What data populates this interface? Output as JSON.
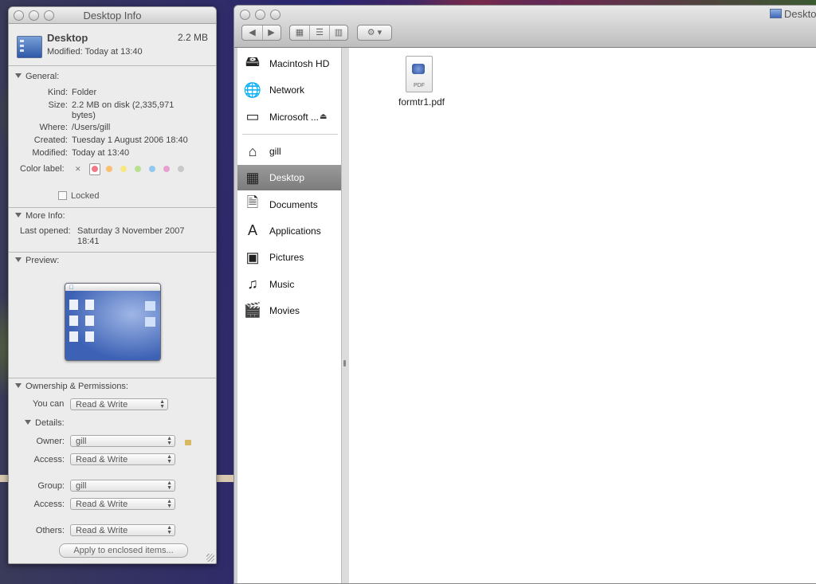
{
  "info_window": {
    "title": "Desktop Info",
    "name": "Desktop",
    "size_short": "2.2 MB",
    "modified_short": "Modified: Today at 13:40",
    "general": {
      "header": "General:",
      "kind_label": "Kind:",
      "kind": "Folder",
      "size_label": "Size:",
      "size_line1": "2.2 MB on disk (2,335,971",
      "size_line2": "bytes)",
      "where_label": "Where:",
      "where": "/Users/gill",
      "created_label": "Created:",
      "created": "Tuesday 1 August 2006 18:40",
      "modified_label": "Modified:",
      "modified": "Today at 13:40",
      "color_label": "Color label:",
      "color_x": "✕",
      "locked": "Locked"
    },
    "more_info": {
      "header": "More Info:",
      "last_opened_label": "Last opened:",
      "last_opened_line1": "Saturday 3 November 2007",
      "last_opened_line2": "18:41"
    },
    "preview": {
      "header": "Preview:"
    },
    "ownership": {
      "header": "Ownership & Permissions:",
      "you_can_label": "You can",
      "you_can": "Read & Write",
      "details_header": "Details:",
      "owner_label": "Owner:",
      "owner": "gill",
      "access1_label": "Access:",
      "access1": "Read & Write",
      "group_label": "Group:",
      "group": "gill",
      "access2_label": "Access:",
      "access2": "Read & Write",
      "others_label": "Others:",
      "others": "Read & Write",
      "apply_button": "Apply to enclosed items..."
    }
  },
  "finder": {
    "title": "Desktop",
    "sidebar_devices": [
      {
        "label": "Macintosh HD",
        "icon": "hard-drive-icon"
      },
      {
        "label": "Network",
        "icon": "network-globe-icon"
      },
      {
        "label": "Microsoft ...",
        "icon": "disk-image-icon"
      }
    ],
    "sidebar_places": [
      {
        "label": "gill",
        "icon": "home-icon"
      },
      {
        "label": "Desktop",
        "icon": "desktop-icon"
      },
      {
        "label": "Documents",
        "icon": "documents-icon"
      },
      {
        "label": "Applications",
        "icon": "applications-icon"
      },
      {
        "label": "Pictures",
        "icon": "pictures-icon"
      },
      {
        "label": "Music",
        "icon": "music-icon"
      },
      {
        "label": "Movies",
        "icon": "movies-icon"
      }
    ],
    "files": [
      {
        "name": "formtr1.pdf",
        "badge": "PDF"
      }
    ]
  }
}
